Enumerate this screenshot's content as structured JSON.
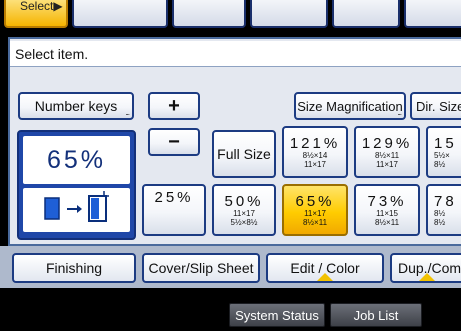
{
  "top_tabs": {
    "selected_label": "Select▶"
  },
  "info": {
    "message": "Select item."
  },
  "buttons": {
    "number_keys": "Number keys",
    "plus": "+",
    "minus": "−",
    "size_magnification": "Size Magnification",
    "dir_size": "Dir. Size",
    "full_size": "Full Size"
  },
  "current_ratio": "65%",
  "presets_top": [
    {
      "pct": "121%",
      "line1": "8½×14",
      "line2": "11×17"
    },
    {
      "pct": "129%",
      "line1": "8½×11",
      "line2": "11×17"
    },
    {
      "pct": "15",
      "line1": "5½×",
      "line2": "8½"
    }
  ],
  "presets_bottom": [
    {
      "pct": "25%",
      "line1": "",
      "line2": ""
    },
    {
      "pct": "50%",
      "line1": "11×17",
      "line2": "5½×8½"
    },
    {
      "pct": "65%",
      "line1": "11×17",
      "line2": "8½×11"
    },
    {
      "pct": "73%",
      "line1": "11×15",
      "line2": "8½×11"
    },
    {
      "pct": "78",
      "line1": "8½",
      "line2": "8½"
    }
  ],
  "tabs": {
    "finishing": "Finishing",
    "cover_slip": "Cover/Slip Sheet",
    "edit_color": "Edit / Color",
    "dup_combine": "Dup./Combine"
  },
  "status": {
    "system_status": "System Status",
    "job_list": "Job List"
  },
  "colors": {
    "accent": "#ffcc00",
    "panel_border": "#1c3b82",
    "big_box": "#1f47a8"
  }
}
